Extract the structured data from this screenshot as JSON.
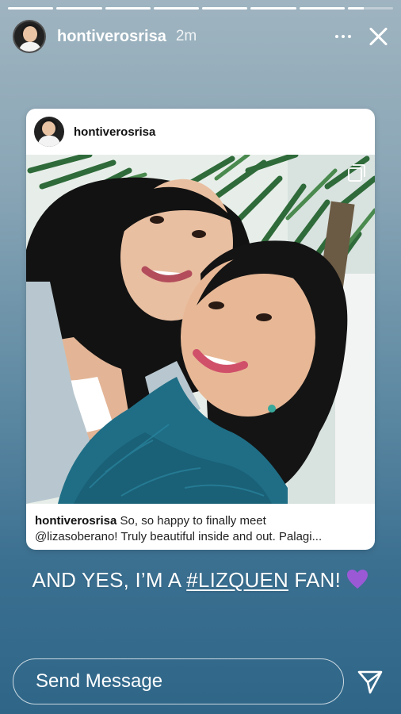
{
  "story": {
    "segments": [
      1,
      1,
      1,
      1,
      1,
      1,
      1,
      0.35
    ],
    "username": "hontiverosrisa",
    "time": "2m"
  },
  "post": {
    "username": "hontiverosrisa",
    "caption_user": "hontiverosrisa",
    "caption_line1": " So, so happy to finally meet",
    "caption_line2": "@lizasoberano! Truly beautiful inside and out. Palagi..."
  },
  "overlay": {
    "text_before": "AND YES, I’M A ",
    "hashtag": "#LIZQUEN",
    "text_after": " FAN! "
  },
  "reply": {
    "placeholder": "Send Message"
  },
  "colors": {
    "heart": "#9b59d6"
  }
}
